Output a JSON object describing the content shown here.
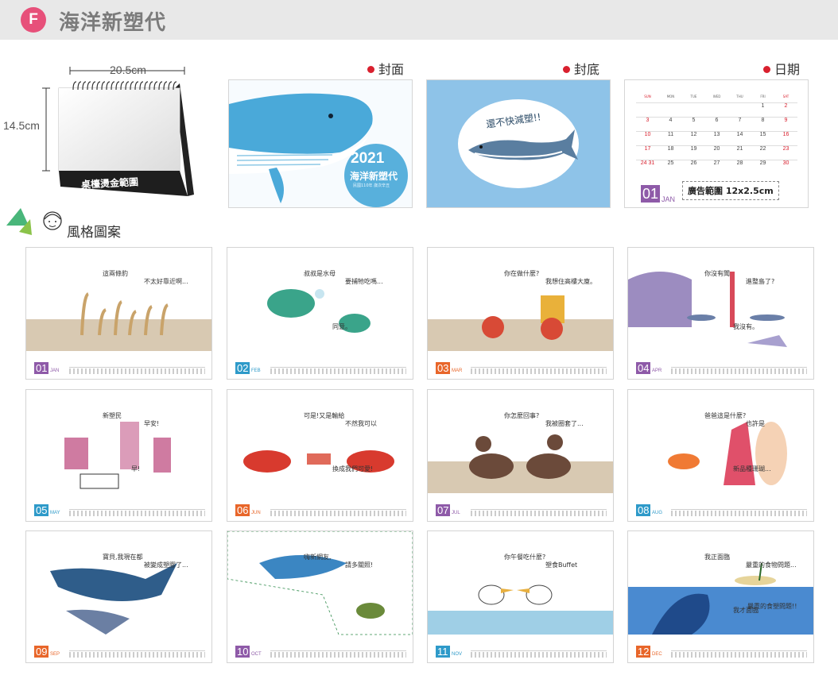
{
  "header": {
    "badge": "F",
    "title": "海洋新塑代"
  },
  "desk": {
    "width_label": "20.5cm",
    "height_label": "14.5cm",
    "base_label": "桌檯燙金範圍"
  },
  "sections": {
    "cover": "封面",
    "back": "封底",
    "date": "日期",
    "style": "風格圖案"
  },
  "cover": {
    "year": "2021",
    "title": "海洋新塑代",
    "sub": "民國110年 歲次辛丑"
  },
  "back": {
    "slogan": "還不快減塑!!"
  },
  "date_page": {
    "weekdays": [
      "SUN",
      "MON",
      "TUE",
      "WED",
      "THU",
      "FRI",
      "SAT"
    ],
    "month_num": "01",
    "month_name": "JAN",
    "ad_label": "廣告範圍 12x2.5cm",
    "rows": [
      [
        "",
        "",
        "",
        "",
        "",
        "1",
        "2"
      ],
      [
        "3",
        "4",
        "5",
        "6",
        "7",
        "8",
        "9"
      ],
      [
        "10",
        "11",
        "12",
        "13",
        "14",
        "15",
        "16"
      ],
      [
        "17",
        "18",
        "19",
        "20",
        "21",
        "22",
        "23"
      ],
      [
        "24 31",
        "25",
        "26",
        "27",
        "28",
        "29",
        "30"
      ]
    ]
  },
  "months": [
    {
      "num": "01",
      "name": "JAN",
      "color": "#8e5aa8",
      "t1": "這兩條豹",
      "t2": "不太好靠近啊..."
    },
    {
      "num": "02",
      "name": "FEB",
      "color": "#2e9ac9",
      "t1": "叔叔是水母",
      "t2": "要捕牠吃嗎...",
      "t3": "同意。"
    },
    {
      "num": "03",
      "name": "MAR",
      "color": "#e8662a",
      "t1": "你在做什麼?",
      "t2": "我想住高樓大廈。"
    },
    {
      "num": "04",
      "name": "APR",
      "color": "#8e5aa8",
      "t1": "你沒有聞",
      "t2": "進整島了?",
      "t3": "我沒有。"
    },
    {
      "num": "05",
      "name": "MAY",
      "color": "#2e9ac9",
      "t1": "新塑民",
      "t2": "早安!",
      "t3": "早!"
    },
    {
      "num": "06",
      "name": "JUN",
      "color": "#e8662a",
      "t1": "可是!又是輸給",
      "t2": "不然我可以",
      "t3": "換成我們可愛!"
    },
    {
      "num": "07",
      "name": "JUL",
      "color": "#8e5aa8",
      "t1": "你怎麼回事?",
      "t2": "我被圈套了..."
    },
    {
      "num": "08",
      "name": "AUG",
      "color": "#2e9ac9",
      "t1": "爸爸這是什麼?",
      "t2": "也許是",
      "t3": "新品種珊瑚..."
    },
    {
      "num": "09",
      "name": "SEP",
      "color": "#e8662a",
      "t1": "寶貝,我現在都",
      "t2": "被變成塑膠了..."
    },
    {
      "num": "10",
      "name": "OCT",
      "color": "#8e5aa8",
      "t1": "嗨新網友,",
      "t2": "請多關照!"
    },
    {
      "num": "11",
      "name": "NOV",
      "color": "#2e9ac9",
      "t1": "你午餐吃什麼?",
      "t2": "塑食Buffet"
    },
    {
      "num": "12",
      "name": "DEC",
      "color": "#e8662a",
      "t1": "我正面臨",
      "t2": "嚴重的食物問題...",
      "t3": "我才面臨",
      "t4": "嚴重的食塑問題!!"
    }
  ]
}
